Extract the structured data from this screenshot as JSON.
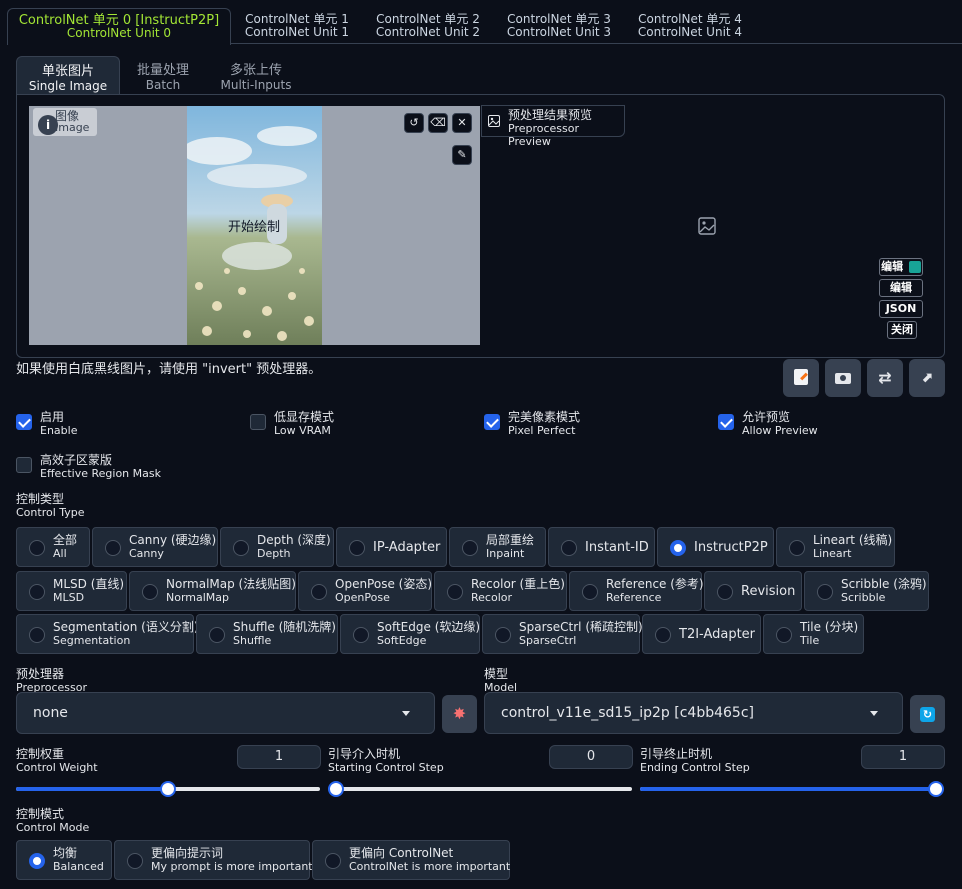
{
  "unit_tabs": [
    {
      "zh": "ControlNet 单元 0 [InstructP2P]",
      "en": "ControlNet Unit 0"
    },
    {
      "zh": "ControlNet 单元 1",
      "en": "ControlNet Unit 1"
    },
    {
      "zh": "ControlNet 单元 2",
      "en": "ControlNet Unit 2"
    },
    {
      "zh": "ControlNet 单元 3",
      "en": "ControlNet Unit 3"
    },
    {
      "zh": "ControlNet 单元 4",
      "en": "ControlNet Unit 4"
    }
  ],
  "input_tabs": [
    {
      "zh": "单张图片",
      "en": "Single Image"
    },
    {
      "zh": "批量处理",
      "en": "Batch"
    },
    {
      "zh": "多张上传",
      "en": "Multi-Inputs"
    }
  ],
  "image_panel": {
    "label_zh": "图像",
    "label_en": "Image",
    "overlay_text": "开始绘制",
    "icons": [
      "undo-icon",
      "eraser-icon",
      "close-icon",
      "brush-icon"
    ]
  },
  "preview_panel": {
    "label_zh": "预处理结果预览",
    "label_en": "Preprocessor Preview",
    "badges": [
      "编辑",
      "编辑",
      "JSON",
      "关闭"
    ]
  },
  "hint": "如果使用白底黑线图片，请使用 \"invert\" 预处理器。",
  "tool_buttons": [
    "edit-icon",
    "camera-icon",
    "swap-icon",
    "send-dimensions-icon"
  ],
  "checkboxes": [
    {
      "zh": "启用",
      "en": "Enable",
      "checked": true
    },
    {
      "zh": "低显存模式",
      "en": "Low VRAM",
      "checked": false
    },
    {
      "zh": "完美像素模式",
      "en": "Pixel Perfect",
      "checked": true
    },
    {
      "zh": "允许预览",
      "en": "Allow Preview",
      "checked": true
    },
    {
      "zh": "高效子区蒙版",
      "en": "Effective Region Mask",
      "checked": false
    }
  ],
  "control_type": {
    "label_zh": "控制类型",
    "label_en": "Control Type",
    "selected": "InstructP2P",
    "options": [
      {
        "zh": "全部",
        "en": "All"
      },
      {
        "zh": "Canny (硬边缘)",
        "en": "Canny"
      },
      {
        "zh": "Depth (深度)",
        "en": "Depth"
      },
      {
        "zh": "IP-Adapter",
        "en": ""
      },
      {
        "zh": "局部重绘",
        "en": "Inpaint"
      },
      {
        "zh": "Instant-ID",
        "en": ""
      },
      {
        "zh": "InstructP2P",
        "en": ""
      },
      {
        "zh": "Lineart (线稿)",
        "en": "Lineart"
      },
      {
        "zh": "MLSD (直线)",
        "en": "MLSD"
      },
      {
        "zh": "NormalMap (法线贴图)",
        "en": "NormalMap"
      },
      {
        "zh": "OpenPose (姿态)",
        "en": "OpenPose"
      },
      {
        "zh": "Recolor (重上色)",
        "en": "Recolor"
      },
      {
        "zh": "Reference (参考)",
        "en": "Reference"
      },
      {
        "zh": "Revision",
        "en": ""
      },
      {
        "zh": "Scribble (涂鸦)",
        "en": "Scribble"
      },
      {
        "zh": "Segmentation (语义分割)",
        "en": "Segmentation"
      },
      {
        "zh": "Shuffle (随机洗牌)",
        "en": "Shuffle"
      },
      {
        "zh": "SoftEdge (软边缘)",
        "en": "SoftEdge"
      },
      {
        "zh": "SparseCtrl (稀疏控制)",
        "en": "SparseCtrl"
      },
      {
        "zh": "T2I-Adapter",
        "en": ""
      },
      {
        "zh": "Tile (分块)",
        "en": "Tile"
      }
    ]
  },
  "preprocessor": {
    "label_zh": "预处理器",
    "label_en": "Preprocessor",
    "value": "none"
  },
  "model": {
    "label_zh": "模型",
    "label_en": "Model",
    "value": "control_v11e_sd15_ip2p [c4bb465c]"
  },
  "sliders": [
    {
      "zh": "控制权重",
      "en": "Control Weight",
      "value": "1",
      "fraction": 0.5
    },
    {
      "zh": "引导介入时机",
      "en": "Starting Control Step",
      "value": "0",
      "fraction": 0.0
    },
    {
      "zh": "引导终止时机",
      "en": "Ending Control Step",
      "value": "1",
      "fraction": 1.0
    }
  ],
  "control_mode": {
    "label_zh": "控制模式",
    "label_en": "Control Mode",
    "options": [
      {
        "zh": "均衡",
        "en": "Balanced",
        "checked": true
      },
      {
        "zh": "更偏向提示词",
        "en": "My prompt is more important",
        "checked": false
      },
      {
        "zh": "更偏向 ControlNet",
        "en": "ControlNet is more important",
        "checked": false
      }
    ]
  },
  "colors": {
    "accent": "#2563eb",
    "active_tab": "#a3e635",
    "background": "#0b0f19",
    "surface": "#1f2937"
  }
}
